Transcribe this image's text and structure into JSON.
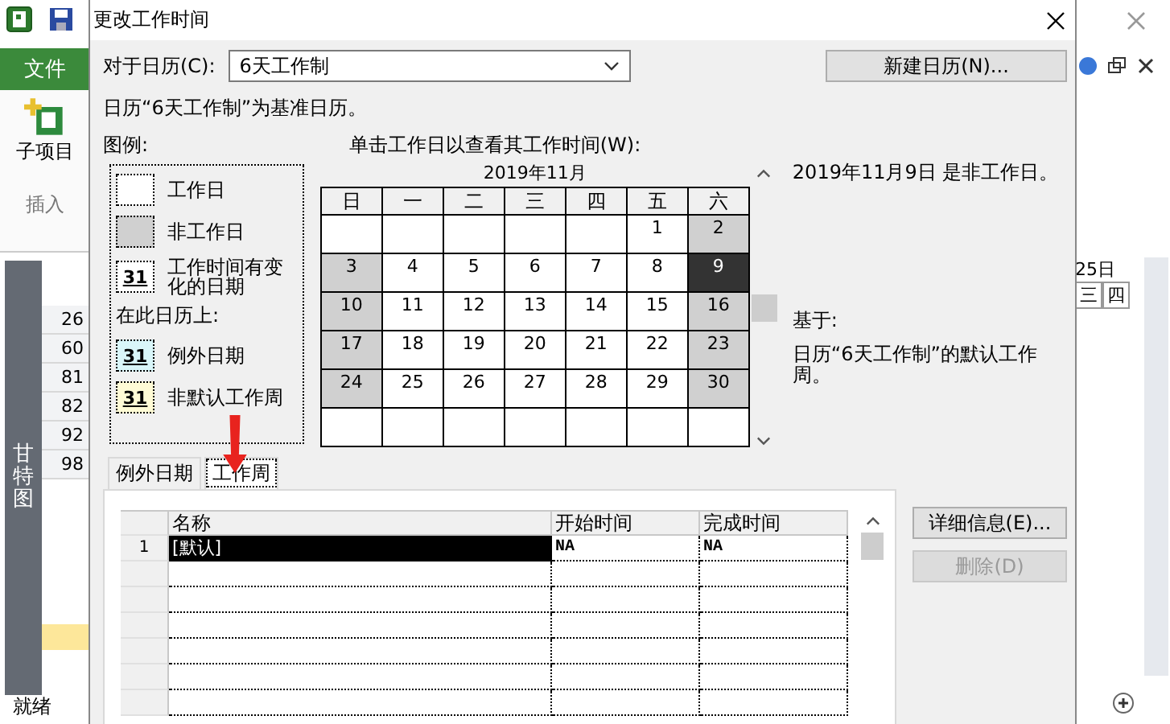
{
  "app": {
    "menu_tab": "文件",
    "ribbon_button": "子项目",
    "ribbon_group": "插入",
    "view_label": "甘特图",
    "row_ids": [
      "26",
      "60",
      "81",
      "82",
      "92",
      "98"
    ],
    "timescale_date": "25日",
    "timescale_days": [
      "三",
      "四"
    ],
    "status": "就绪"
  },
  "dialog": {
    "title": "更改工作时间",
    "calendar_label": "对于日历(C):",
    "calendar_value": "6天工作制",
    "new_calendar_button": "新建日历(N)...",
    "base_note": "日历“6天工作制”为基准日历。",
    "legend": {
      "title": "图例:",
      "items": [
        {
          "kind": "working",
          "label": "工作日"
        },
        {
          "kind": "nonworking",
          "label": "非工作日"
        },
        {
          "kind": "changed",
          "sample": "31",
          "label": "工作时间有变化的日期"
        }
      ],
      "subtitle": "在此日历上:",
      "calendar_items": [
        {
          "kind": "exception",
          "sample": "31",
          "label": "例外日期"
        },
        {
          "kind": "nondefault",
          "sample": "31",
          "label": "非默认工作周"
        }
      ]
    },
    "calendar": {
      "instruction": "单击工作日以查看其工作时间(W):",
      "month": "2019年11月",
      "weekdays": [
        "日",
        "一",
        "二",
        "三",
        "四",
        "五",
        "六"
      ],
      "weeks": [
        [
          {
            "nonworking": false,
            "selected": false
          },
          {
            "nonworking": false,
            "selected": false
          },
          {
            "nonworking": false,
            "selected": false
          },
          {
            "nonworking": false,
            "selected": false
          },
          {
            "nonworking": false,
            "selected": false
          },
          {
            "day": "1",
            "nonworking": false,
            "selected": false
          },
          {
            "day": "2",
            "nonworking": true,
            "selected": false
          }
        ],
        [
          {
            "day": "3",
            "nonworking": true,
            "selected": false
          },
          {
            "day": "4",
            "nonworking": false,
            "selected": false
          },
          {
            "day": "5",
            "nonworking": false,
            "selected": false
          },
          {
            "day": "6",
            "nonworking": false,
            "selected": false
          },
          {
            "day": "7",
            "nonworking": false,
            "selected": false
          },
          {
            "day": "8",
            "nonworking": false,
            "selected": false
          },
          {
            "day": "9",
            "nonworking": true,
            "selected": true
          }
        ],
        [
          {
            "day": "10",
            "nonworking": true,
            "selected": false
          },
          {
            "day": "11",
            "nonworking": false,
            "selected": false
          },
          {
            "day": "12",
            "nonworking": false,
            "selected": false
          },
          {
            "day": "13",
            "nonworking": false,
            "selected": false
          },
          {
            "day": "14",
            "nonworking": false,
            "selected": false
          },
          {
            "day": "15",
            "nonworking": false,
            "selected": false
          },
          {
            "day": "16",
            "nonworking": true,
            "selected": false
          }
        ],
        [
          {
            "day": "17",
            "nonworking": true,
            "selected": false
          },
          {
            "day": "18",
            "nonworking": false,
            "selected": false
          },
          {
            "day": "19",
            "nonworking": false,
            "selected": false
          },
          {
            "day": "20",
            "nonworking": false,
            "selected": false
          },
          {
            "day": "21",
            "nonworking": false,
            "selected": false
          },
          {
            "day": "22",
            "nonworking": false,
            "selected": false
          },
          {
            "day": "23",
            "nonworking": true,
            "selected": false
          }
        ],
        [
          {
            "day": "24",
            "nonworking": true,
            "selected": false
          },
          {
            "day": "25",
            "nonworking": false,
            "selected": false
          },
          {
            "day": "26",
            "nonworking": false,
            "selected": false
          },
          {
            "day": "27",
            "nonworking": false,
            "selected": false
          },
          {
            "day": "28",
            "nonworking": false,
            "selected": false
          },
          {
            "day": "29",
            "nonworking": false,
            "selected": false
          },
          {
            "day": "30",
            "nonworking": true,
            "selected": false
          }
        ],
        [
          {
            "nonworking": false,
            "selected": false
          },
          {
            "nonworking": false,
            "selected": false
          },
          {
            "nonworking": false,
            "selected": false
          },
          {
            "nonworking": false,
            "selected": false
          },
          {
            "nonworking": false,
            "selected": false
          },
          {
            "nonworking": false,
            "selected": false
          },
          {
            "nonworking": false,
            "selected": false
          }
        ]
      ]
    },
    "info": {
      "selected_date_note": "2019年11月9日 是非工作日。",
      "based_on_label": "基于:",
      "based_on_text": "日历“6天工作制”的默认工作周。"
    },
    "tabs": [
      {
        "label": "例外日期",
        "selected": false
      },
      {
        "label": "工作周",
        "selected": true
      }
    ],
    "table": {
      "columns": [
        "名称",
        "开始时间",
        "完成时间"
      ],
      "rows": [
        {
          "id": "1",
          "name": "[默认]",
          "start": "NA",
          "finish": "NA",
          "selected": true
        }
      ]
    },
    "buttons": [
      {
        "label": "详细信息(E)...",
        "disabled": false
      },
      {
        "label": "删除(D)",
        "disabled": true
      }
    ]
  }
}
